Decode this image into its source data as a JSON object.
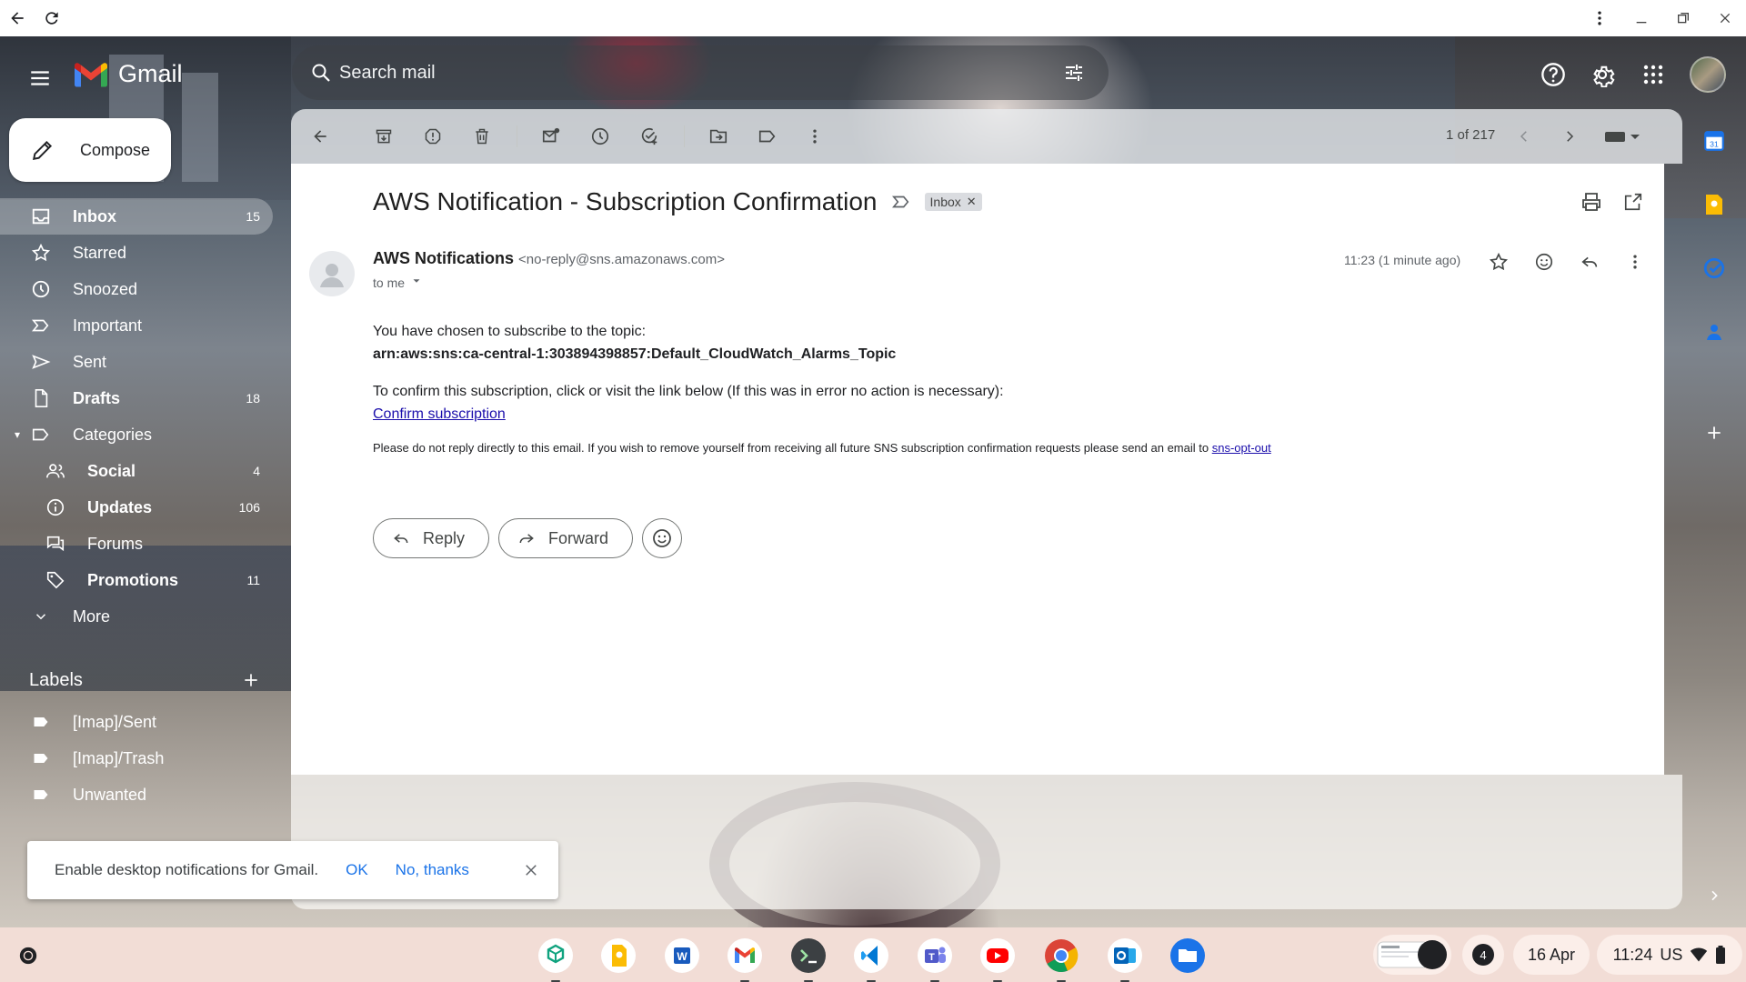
{
  "browser": {
    "back_label": "Back",
    "reload_label": "Reload"
  },
  "gmail": {
    "wordmark": "Gmail",
    "search_placeholder": "Search mail"
  },
  "compose_label": "Compose",
  "nav": [
    {
      "label": "Inbox",
      "count": "15",
      "icon": "inbox-icon"
    },
    {
      "label": "Starred",
      "count": "",
      "icon": "star-icon"
    },
    {
      "label": "Snoozed",
      "count": "",
      "icon": "clock-icon"
    },
    {
      "label": "Important",
      "count": "",
      "icon": "label-important-icon"
    },
    {
      "label": "Sent",
      "count": "",
      "icon": "send-icon"
    },
    {
      "label": "Drafts",
      "count": "18",
      "icon": "draft-icon"
    },
    {
      "label": "Categories",
      "count": "",
      "icon": "label-icon"
    },
    {
      "label": "Social",
      "count": "4",
      "icon": "people-icon"
    },
    {
      "label": "Updates",
      "count": "106",
      "icon": "info-icon"
    },
    {
      "label": "Forums",
      "count": "",
      "icon": "forum-icon"
    },
    {
      "label": "Promotions",
      "count": "11",
      "icon": "tag-icon"
    },
    {
      "label": "More",
      "count": "",
      "icon": "chevron-down-icon"
    }
  ],
  "labels_section": {
    "title": "Labels",
    "items": [
      "[Imap]/Sent",
      "[Imap]/Trash",
      "Unwanted"
    ]
  },
  "toolbar": {
    "count_text": "1 of 217"
  },
  "message": {
    "subject": "AWS Notification - Subscription Confirmation",
    "label_chip": "Inbox",
    "sender_name": "AWS Notifications",
    "sender_email": "<no-reply@sns.amazonaws.com>",
    "to_text": "to me",
    "time": "11:23 (1 minute ago)",
    "body_line1": "You have chosen to subscribe to the topic:",
    "body_arn": "arn:aws:sns:ca-central-1:303894398857:Default_CloudWatch_Alarms_Topic",
    "body_line2": "To confirm this subscription, click or visit the link below (If this was in error no action is necessary):",
    "confirm_link": "Confirm subscription",
    "footer_text": "Please do not reply directly to this email. If you wish to remove yourself from receiving all future SNS subscription confirmation requests please send an email to ",
    "optout_link": "sns-opt-out"
  },
  "actions": {
    "reply": "Reply",
    "forward": "Forward"
  },
  "notification": {
    "text": "Enable desktop notifications for Gmail.",
    "ok": "OK",
    "no": "No, thanks"
  },
  "shelf": {
    "badge_count": "4",
    "date": "16 Apr",
    "time": "11:24",
    "locale": "US"
  },
  "colors": {
    "accent_blue": "#1a73e8",
    "link": "#1a0dab",
    "shelf_bg": "#f2ddd6"
  }
}
